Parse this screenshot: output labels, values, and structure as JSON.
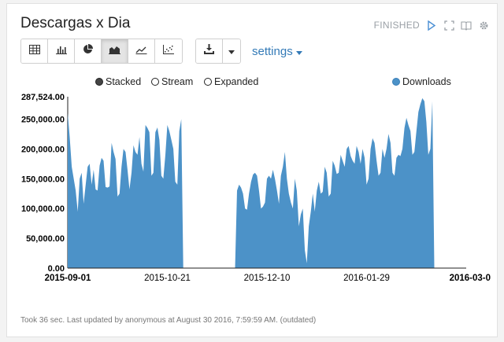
{
  "widget": {
    "title": "Descargas x Dia",
    "status": "FINISHED",
    "settings_label": "settings",
    "footer": "Took 36 sec. Last updated by anonymous at August 30 2016, 7:59:59 AM. (outdated)"
  },
  "toolbar": {
    "chart_buttons": [
      "table-icon",
      "bar-chart-icon",
      "pie-chart-icon",
      "area-chart-icon",
      "line-chart-icon",
      "scatter-chart-icon"
    ],
    "active_index": 3
  },
  "legend": {
    "modes": [
      "Stacked",
      "Stream",
      "Expanded"
    ],
    "selected_mode": "Stacked"
  },
  "colors": {
    "series": "#4c92c8",
    "link": "#337ab7"
  },
  "chart_data": {
    "type": "area",
    "xtick_labels": [
      "2015-09-01",
      "2015-10-21",
      "2015-12-10",
      "2016-01-29",
      "2016-03-0"
    ],
    "xlim": [
      "2015-09-01",
      "2016-03-19"
    ],
    "ytick_labels": [
      "287,524.00",
      "250,000.00",
      "200,000.00",
      "150,000.00",
      "100,000.00",
      "50,000.00",
      "0.00"
    ],
    "ylim": [
      0,
      287524
    ],
    "series": [
      {
        "name": "Downloads",
        "points": [
          [
            "2015-09-01",
            260000
          ],
          [
            "2015-09-02",
            220000
          ],
          [
            "2015-09-03",
            170000
          ],
          [
            "2015-09-04",
            150000
          ],
          [
            "2015-09-05",
            130000
          ],
          [
            "2015-09-06",
            95000
          ],
          [
            "2015-09-07",
            150000
          ],
          [
            "2015-09-08",
            160000
          ],
          [
            "2015-09-09",
            108000
          ],
          [
            "2015-09-10",
            140000
          ],
          [
            "2015-09-11",
            170000
          ],
          [
            "2015-09-12",
            175000
          ],
          [
            "2015-09-13",
            140000
          ],
          [
            "2015-09-14",
            165000
          ],
          [
            "2015-09-15",
            132000
          ],
          [
            "2015-09-16",
            130000
          ],
          [
            "2015-09-17",
            172000
          ],
          [
            "2015-09-18",
            185000
          ],
          [
            "2015-09-19",
            180000
          ],
          [
            "2015-09-20",
            136000
          ],
          [
            "2015-09-21",
            135000
          ],
          [
            "2015-09-22",
            137000
          ],
          [
            "2015-09-23",
            210000
          ],
          [
            "2015-09-24",
            195000
          ],
          [
            "2015-09-25",
            183000
          ],
          [
            "2015-09-26",
            120000
          ],
          [
            "2015-09-27",
            125000
          ],
          [
            "2015-09-28",
            170000
          ],
          [
            "2015-09-29",
            200000
          ],
          [
            "2015-09-30",
            195000
          ],
          [
            "2015-10-01",
            165000
          ],
          [
            "2015-10-02",
            132000
          ],
          [
            "2015-10-03",
            160000
          ],
          [
            "2015-10-04",
            206000
          ],
          [
            "2015-10-05",
            195000
          ],
          [
            "2015-10-06",
            190000
          ],
          [
            "2015-10-07",
            220000
          ],
          [
            "2015-10-08",
            175000
          ],
          [
            "2015-10-09",
            162000
          ],
          [
            "2015-10-10",
            240000
          ],
          [
            "2015-10-11",
            235000
          ],
          [
            "2015-10-12",
            228000
          ],
          [
            "2015-10-13",
            155000
          ],
          [
            "2015-10-14",
            160000
          ],
          [
            "2015-10-15",
            228000
          ],
          [
            "2015-10-16",
            236000
          ],
          [
            "2015-10-17",
            215000
          ],
          [
            "2015-10-18",
            155000
          ],
          [
            "2015-10-19",
            150000
          ],
          [
            "2015-10-20",
            190000
          ],
          [
            "2015-10-21",
            240000
          ],
          [
            "2015-10-22",
            230000
          ],
          [
            "2015-10-23",
            215000
          ],
          [
            "2015-10-24",
            200000
          ],
          [
            "2015-10-25",
            145000
          ],
          [
            "2015-10-26",
            140000
          ],
          [
            "2015-10-27",
            230000
          ],
          [
            "2015-10-28",
            250000
          ],
          [
            "2015-10-29",
            0
          ],
          [
            "2015-11-24",
            0
          ],
          [
            "2015-11-25",
            130000
          ],
          [
            "2015-11-26",
            140000
          ],
          [
            "2015-11-27",
            135000
          ],
          [
            "2015-11-28",
            125000
          ],
          [
            "2015-11-29",
            100000
          ],
          [
            "2015-11-30",
            98000
          ],
          [
            "2015-12-01",
            125000
          ],
          [
            "2015-12-02",
            145000
          ],
          [
            "2015-12-03",
            157000
          ],
          [
            "2015-12-04",
            160000
          ],
          [
            "2015-12-05",
            155000
          ],
          [
            "2015-12-06",
            130000
          ],
          [
            "2015-12-07",
            100000
          ],
          [
            "2015-12-08",
            103000
          ],
          [
            "2015-12-09",
            110000
          ],
          [
            "2015-12-10",
            150000
          ],
          [
            "2015-12-11",
            155000
          ],
          [
            "2015-12-12",
            150000
          ],
          [
            "2015-12-13",
            165000
          ],
          [
            "2015-12-14",
            150000
          ],
          [
            "2015-12-15",
            130000
          ],
          [
            "2015-12-16",
            108000
          ],
          [
            "2015-12-17",
            155000
          ],
          [
            "2015-12-18",
            170000
          ],
          [
            "2015-12-19",
            195000
          ],
          [
            "2015-12-20",
            150000
          ],
          [
            "2015-12-21",
            125000
          ],
          [
            "2015-12-22",
            110000
          ],
          [
            "2015-12-23",
            100000
          ],
          [
            "2015-12-24",
            150000
          ],
          [
            "2015-12-25",
            130000
          ],
          [
            "2015-12-26",
            70000
          ],
          [
            "2015-12-27",
            90000
          ],
          [
            "2015-12-28",
            100000
          ],
          [
            "2015-12-29",
            30000
          ],
          [
            "2015-12-30",
            8000
          ],
          [
            "2015-12-31",
            70000
          ],
          [
            "2016-01-01",
            95000
          ],
          [
            "2016-01-02",
            125000
          ],
          [
            "2016-01-03",
            95000
          ],
          [
            "2016-01-04",
            130000
          ],
          [
            "2016-01-05",
            145000
          ],
          [
            "2016-01-06",
            125000
          ],
          [
            "2016-01-07",
            128000
          ],
          [
            "2016-01-08",
            170000
          ],
          [
            "2016-01-09",
            160000
          ],
          [
            "2016-01-10",
            120000
          ],
          [
            "2016-01-11",
            125000
          ],
          [
            "2016-01-12",
            180000
          ],
          [
            "2016-01-13",
            172000
          ],
          [
            "2016-01-14",
            158000
          ],
          [
            "2016-01-15",
            160000
          ],
          [
            "2016-01-16",
            190000
          ],
          [
            "2016-01-17",
            180000
          ],
          [
            "2016-01-18",
            170000
          ],
          [
            "2016-01-19",
            200000
          ],
          [
            "2016-01-20",
            205000
          ],
          [
            "2016-01-21",
            188000
          ],
          [
            "2016-01-22",
            180000
          ],
          [
            "2016-01-23",
            175000
          ],
          [
            "2016-01-24",
            205000
          ],
          [
            "2016-01-25",
            195000
          ],
          [
            "2016-01-26",
            175000
          ],
          [
            "2016-01-27",
            200000
          ],
          [
            "2016-01-28",
            185000
          ],
          [
            "2016-01-29",
            140000
          ],
          [
            "2016-01-30",
            150000
          ],
          [
            "2016-01-31",
            200000
          ],
          [
            "2016-02-01",
            218000
          ],
          [
            "2016-02-02",
            210000
          ],
          [
            "2016-02-03",
            180000
          ],
          [
            "2016-02-04",
            155000
          ],
          [
            "2016-02-05",
            160000
          ],
          [
            "2016-02-06",
            200000
          ],
          [
            "2016-02-07",
            185000
          ],
          [
            "2016-02-08",
            200000
          ],
          [
            "2016-02-09",
            225000
          ],
          [
            "2016-02-10",
            210000
          ],
          [
            "2016-02-11",
            160000
          ],
          [
            "2016-02-12",
            155000
          ],
          [
            "2016-02-13",
            185000
          ],
          [
            "2016-02-14",
            190000
          ],
          [
            "2016-02-15",
            188000
          ],
          [
            "2016-02-16",
            200000
          ],
          [
            "2016-02-17",
            235000
          ],
          [
            "2016-02-18",
            252000
          ],
          [
            "2016-02-19",
            240000
          ],
          [
            "2016-02-20",
            230000
          ],
          [
            "2016-02-21",
            190000
          ],
          [
            "2016-02-22",
            195000
          ],
          [
            "2016-02-23",
            230000
          ],
          [
            "2016-02-24",
            262000
          ],
          [
            "2016-02-25",
            275000
          ],
          [
            "2016-02-26",
            285000
          ],
          [
            "2016-02-27",
            280000
          ],
          [
            "2016-02-28",
            245000
          ],
          [
            "2016-02-29",
            190000
          ],
          [
            "2016-03-01",
            200000
          ],
          [
            "2016-03-02",
            280000
          ],
          [
            "2016-03-03",
            0
          ]
        ]
      }
    ]
  }
}
